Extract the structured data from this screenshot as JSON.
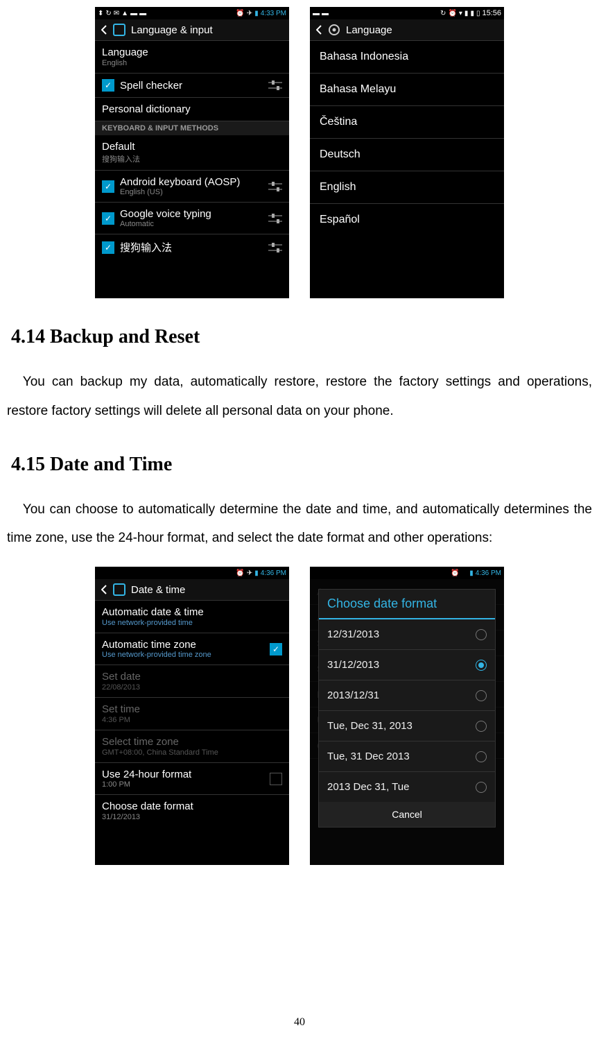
{
  "page_number": "40",
  "sections": {
    "s414_title": "4.14 Backup and Reset",
    "s414_body": "You can backup my data, automatically restore, restore the factory settings and operations, restore factory settings will delete all personal data on your phone.",
    "s415_title": "4.15 Date and Time",
    "s415_body": "You can choose to automatically determine the date and time, and automatically determines the time zone, use the 24-hour format, and select the date format and other operations:"
  },
  "screenshot_lang_input": {
    "status_time": "4:33 PM",
    "header": "Language & input",
    "items": {
      "language_title": "Language",
      "language_sub": "English",
      "spell_checker": "Spell checker",
      "personal_dict": "Personal dictionary",
      "section_kbd": "KEYBOARD & INPUT METHODS",
      "default_title": "Default",
      "default_sub": "搜狗输入法",
      "aosp_title": "Android keyboard (AOSP)",
      "aosp_sub": "English (US)",
      "voice_title": "Google voice typing",
      "voice_sub": "Automatic",
      "sogou": "搜狗输入法"
    }
  },
  "screenshot_lang_list": {
    "status_time": "15:56",
    "header": "Language",
    "options": [
      "Bahasa Indonesia",
      "Bahasa Melayu",
      "Čeština",
      "Deutsch",
      "English",
      "Español"
    ]
  },
  "screenshot_datetime": {
    "status_time": "4:36 PM",
    "header": "Date & time",
    "auto_dt_title": "Automatic date & time",
    "auto_dt_sub": "Use network-provided time",
    "auto_tz_title": "Automatic time zone",
    "auto_tz_sub": "Use network-provided time zone",
    "set_date_title": "Set date",
    "set_date_sub": "22/08/2013",
    "set_time_title": "Set time",
    "set_time_sub": "4:36 PM",
    "select_tz_title": "Select time zone",
    "select_tz_sub": "GMT+08:00, China Standard Time",
    "use24_title": "Use 24-hour format",
    "use24_sub": "1:00 PM",
    "choose_fmt_title": "Choose date format",
    "choose_fmt_sub": "31/12/2013"
  },
  "screenshot_dialog": {
    "status_time": "4:36 PM",
    "dialog_title": "Choose date format",
    "options": [
      "12/31/2013",
      "31/12/2013",
      "2013/12/31",
      "Tue, Dec 31, 2013",
      "Tue, 31 Dec 2013",
      "2013 Dec 31, Tue"
    ],
    "selected_index": 1,
    "cancel": "Cancel"
  }
}
